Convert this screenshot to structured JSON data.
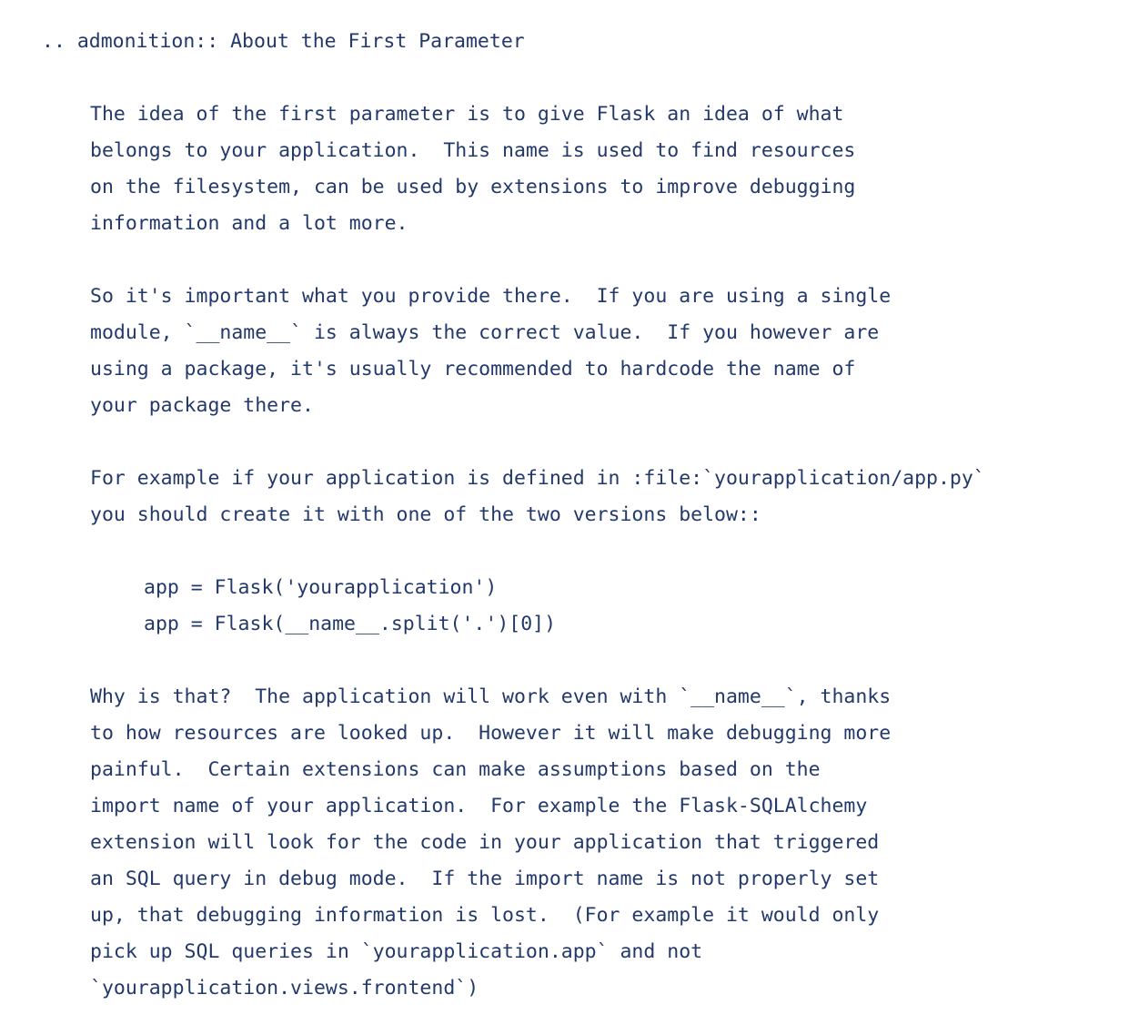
{
  "document": {
    "kind": "restructuredtext-source",
    "background_color": "#ffffff",
    "text_color": "#23396b",
    "directive_title": ".. admonition:: About the First Parameter",
    "blocks": [
      {
        "id": "directive",
        "type": "directive-line",
        "indent": 0,
        "lines": [
          ".. admonition:: About the First Parameter"
        ]
      },
      {
        "id": "paragraph-1",
        "type": "paragraph",
        "indent": 1,
        "lines": [
          "The idea of the first parameter is to give Flask an idea of what",
          "belongs to your application.  This name is used to find resources",
          "on the filesystem, can be used by extensions to improve debugging",
          "information and a lot more."
        ]
      },
      {
        "id": "paragraph-2",
        "type": "paragraph",
        "indent": 1,
        "lines": [
          "So it's important what you provide there.  If you are using a single",
          "module, `__name__` is always the correct value.  If you however are",
          "using a package, it's usually recommended to hardcode the name of",
          "your package there."
        ]
      },
      {
        "id": "paragraph-3",
        "type": "paragraph",
        "indent": 1,
        "lines": [
          "For example if your application is defined in :file:`yourapplication/app.py`",
          "you should create it with one of the two versions below::"
        ]
      },
      {
        "id": "literal-block",
        "type": "literal-block",
        "indent": 2,
        "lines": [
          "app = Flask('yourapplication')",
          "app = Flask(__name__.split('.')[0])"
        ]
      },
      {
        "id": "paragraph-4",
        "type": "paragraph",
        "indent": 1,
        "lines": [
          "Why is that?  The application will work even with `__name__`, thanks",
          "to how resources are looked up.  However it will make debugging more",
          "painful.  Certain extensions can make assumptions based on the",
          "import name of your application.  For example the Flask-SQLAlchemy",
          "extension will look for the code in your application that triggered",
          "an SQL query in debug mode.  If the import name is not properly set",
          "up, that debugging information is lost.  (For example it would only",
          "pick up SQL queries in `yourapplication.app` and not",
          "`yourapplication.views.frontend`)"
        ]
      }
    ]
  }
}
